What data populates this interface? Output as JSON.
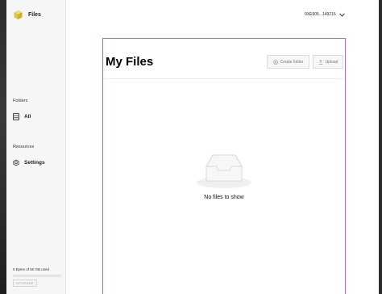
{
  "app": {
    "name": "Files"
  },
  "sidebar": {
    "folders_label": "Folders",
    "all_label": "All",
    "resources_label": "Resources",
    "settings_label": "Settings",
    "usage_text": "0 Bytes of 50 GB used",
    "usage_fraction": 0.0,
    "upgrade_label": "UPGRADE"
  },
  "header": {
    "account": "0XE605...149216"
  },
  "main": {
    "title": "My Files",
    "create_folder_label": "Create folder",
    "upload_label": "Upload",
    "empty_text": "No files to show"
  },
  "colors": {
    "brand": "#e9d64a",
    "panel_outline": "#c75bc7",
    "sidebar_bg": "#f6f6f6"
  },
  "icons": {
    "brand": "cube-logo-icon",
    "all": "folder-list-icon",
    "settings": "gear-icon",
    "account": "chevron-down-icon",
    "create": "plus-circle-icon",
    "upload": "upload-icon",
    "empty": "empty-inbox-icon"
  }
}
